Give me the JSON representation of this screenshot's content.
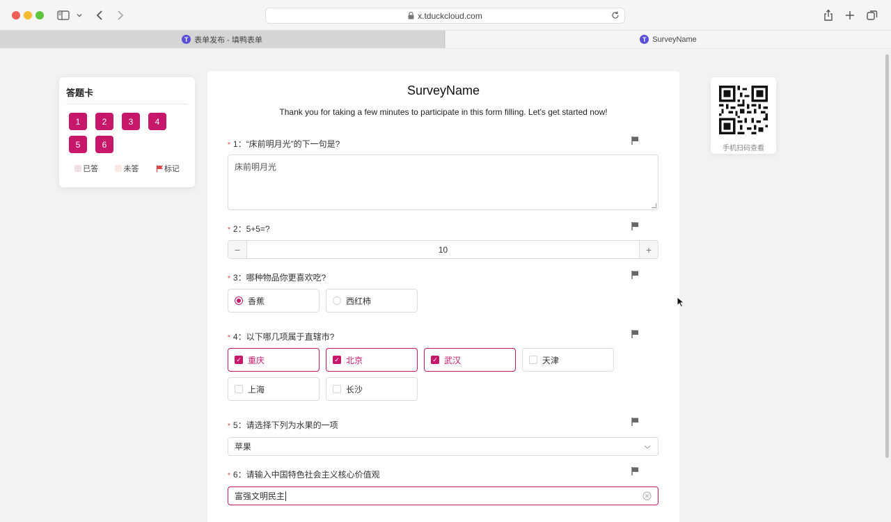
{
  "browser": {
    "url": "x.tduckcloud.com",
    "tabs": [
      {
        "label": "表单发布 - 填鸭表单",
        "favicon": "T"
      },
      {
        "label": "SurveyName",
        "favicon": "T"
      }
    ]
  },
  "answer_card": {
    "title": "答题卡",
    "numbers": [
      "1",
      "2",
      "3",
      "4",
      "5",
      "6"
    ],
    "legend": {
      "answered": "已答",
      "unanswered": "未答",
      "marked": "标记"
    }
  },
  "form": {
    "title": "SurveyName",
    "description": "Thank you for taking a few minutes to participate in this form filling. Let's get started now!",
    "q1": {
      "label": "1：“床前明月光”的下一句是?",
      "value": "床前明月光"
    },
    "q2": {
      "label": "2：5+5=?",
      "value": "10",
      "minus": "−",
      "plus": "+"
    },
    "q3": {
      "label": "3：哪种物品你更喜欢吃?",
      "options": [
        "香蕉",
        "西红柿"
      ],
      "selected": "香蕉"
    },
    "q4": {
      "label": "4：以下哪几项属于直辖市?",
      "options": [
        "重庆",
        "北京",
        "武汉",
        "天津",
        "上海",
        "长沙"
      ],
      "checked": [
        "重庆",
        "北京",
        "武汉"
      ]
    },
    "q5": {
      "label": "5：请选择下列为水果的一项",
      "value": "苹果"
    },
    "q6": {
      "label": "6：请输入中国特色社会主义核心价值观",
      "value": "富强文明民主"
    },
    "required_mark": "*"
  },
  "qr": {
    "caption": "手机扫码查看"
  },
  "colors": {
    "accent": "#c6176a",
    "required": "#e23a3a"
  }
}
